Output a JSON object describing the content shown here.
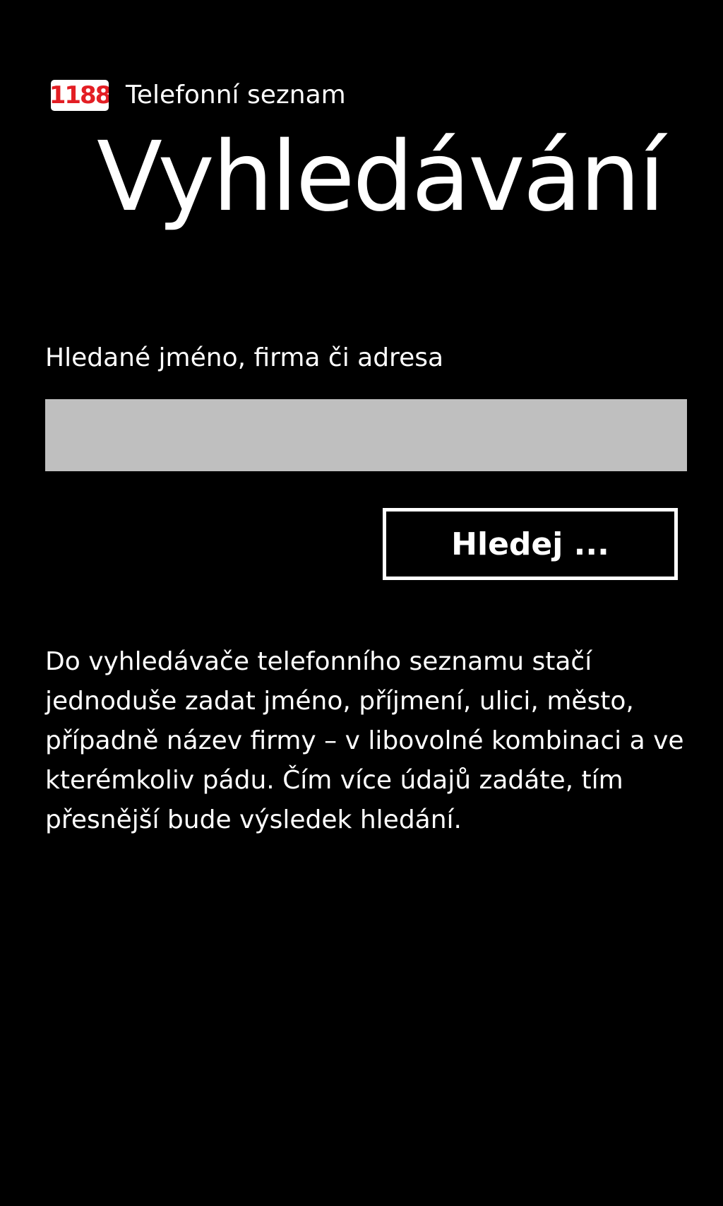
{
  "header": {
    "logo_text": "1188",
    "app_name": "Telefonní seznam",
    "logo_colors": {
      "text": "#e31e24",
      "background": "#ffffff"
    }
  },
  "page": {
    "title": "Vyhledávání"
  },
  "search": {
    "label": "Hledané jméno, firma či adresa",
    "value": "",
    "placeholder": "",
    "button_label": "Hledej ..."
  },
  "description": {
    "text": "Do vyhledávače telefonního seznamu stačí jednoduše zadat jméno, příjmení, ulici, město, případně název firmy – v libovolné kombinaci a ve kterémkoliv pádu. Čím více údajů zadáte, tím přesnější bude výsledek hledání."
  },
  "theme": {
    "background": "#000000",
    "foreground": "#ffffff",
    "input_background": "#bfbfbf"
  }
}
